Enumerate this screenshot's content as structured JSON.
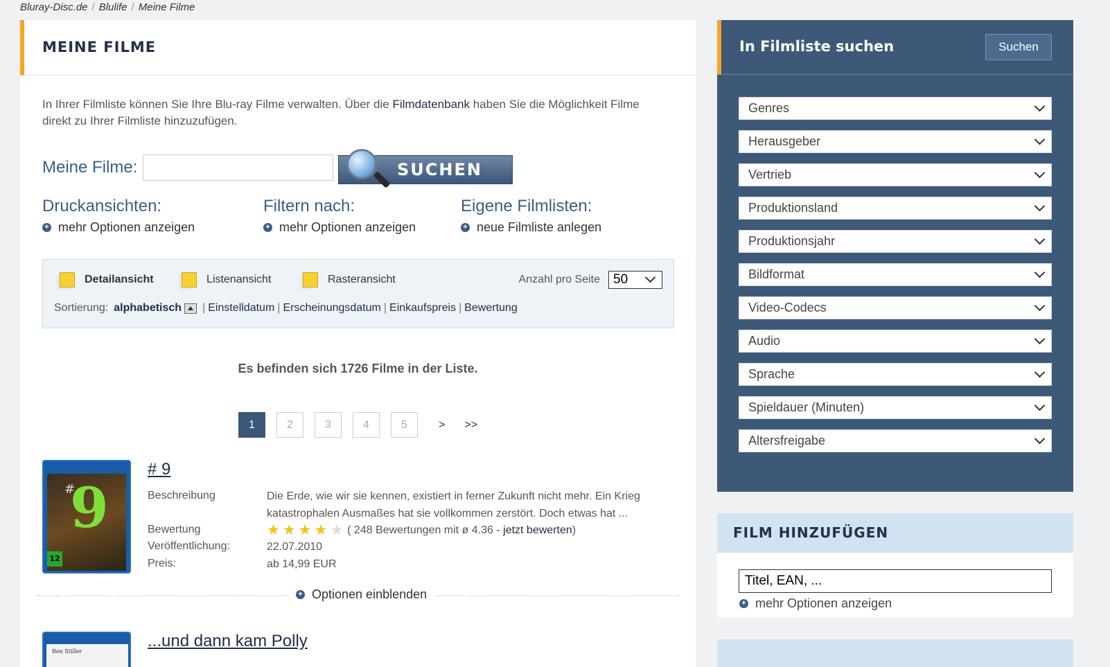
{
  "breadcrumb": [
    "Bluray-Disc.de",
    "Blulife",
    "Meine Filme"
  ],
  "main": {
    "title": "MEINE FILME",
    "intro_pre": "In Ihrer Filmliste können Sie Ihre Blu-ray Filme verwalten. Über die ",
    "intro_link": "Filmdatenbank",
    "intro_post": " haben Sie die Möglichkeit Filme direkt zu Ihrer Filmliste hinzuzufügen.",
    "search_label": "Meine Filme:",
    "search_value": "",
    "search_button": "SUCHEN",
    "options": [
      {
        "title": "Druckansichten:",
        "link": "mehr Optionen anzeigen"
      },
      {
        "title": "Filtern nach:",
        "link": "mehr Optionen anzeigen"
      },
      {
        "title": "Eigene Filmlisten:",
        "link": "neue Filmliste anlegen"
      }
    ],
    "views": [
      "Detailansicht",
      "Listenansicht",
      "Rasteransicht"
    ],
    "per_page_label": "Anzahl pro Seite",
    "per_page_value": "50",
    "sort_label": "Sortierung:",
    "sort_active": "alphabetisch",
    "sort_options": [
      "Einstelldatum",
      "Erscheinungsdatum",
      "Einkaufspreis",
      "Bewertung"
    ],
    "count_text": "Es befinden sich 1726 Filme in der Liste.",
    "pages": [
      "1",
      "2",
      "3",
      "4",
      "5"
    ],
    "page_next": ">",
    "page_last": ">>",
    "movies": [
      {
        "title": "# 9",
        "label_desc": "Beschreibung",
        "desc_line1": "Die Erde, wie wir sie kennen, existiert in ferner Zukunft nicht mehr. Ein Krieg",
        "desc_line2": "katastrophalen Ausmaßes hat sie vollkommen zerstört. Doch etwas hat ...",
        "label_rating": "Bewertung",
        "stars_filled": 4,
        "rating_text": "( 248 Bewertungen mit ø 4.36 - ",
        "rating_link": "jetzt bewerten",
        "rating_close": ")",
        "label_release": "Veröffentlichung:",
        "release": "22.07.2010",
        "label_price": "Preis:",
        "price": "ab 14,99 EUR",
        "cover_fsk": "12",
        "cover_number": "9",
        "cover_hash": "#"
      },
      {
        "title": "...und dann kam Polly",
        "cover_text": "Ben Stiller"
      }
    ],
    "show_options": "Optionen einblenden"
  },
  "sidebar": {
    "title": "In Filmliste suchen",
    "button": "Suchen",
    "filters": [
      "Genres",
      "Herausgeber",
      "Vertrieb",
      "Produktionsland",
      "Produktionsjahr",
      "Bildformat",
      "Video-Codecs",
      "Audio",
      "Sprache",
      "Spieldauer (Minuten)",
      "Altersfreigabe"
    ]
  },
  "add": {
    "title": "FILM HINZUFÜGEN",
    "input_value": "Titel, EAN, ...",
    "more_options": "mehr Optionen anzeigen"
  }
}
